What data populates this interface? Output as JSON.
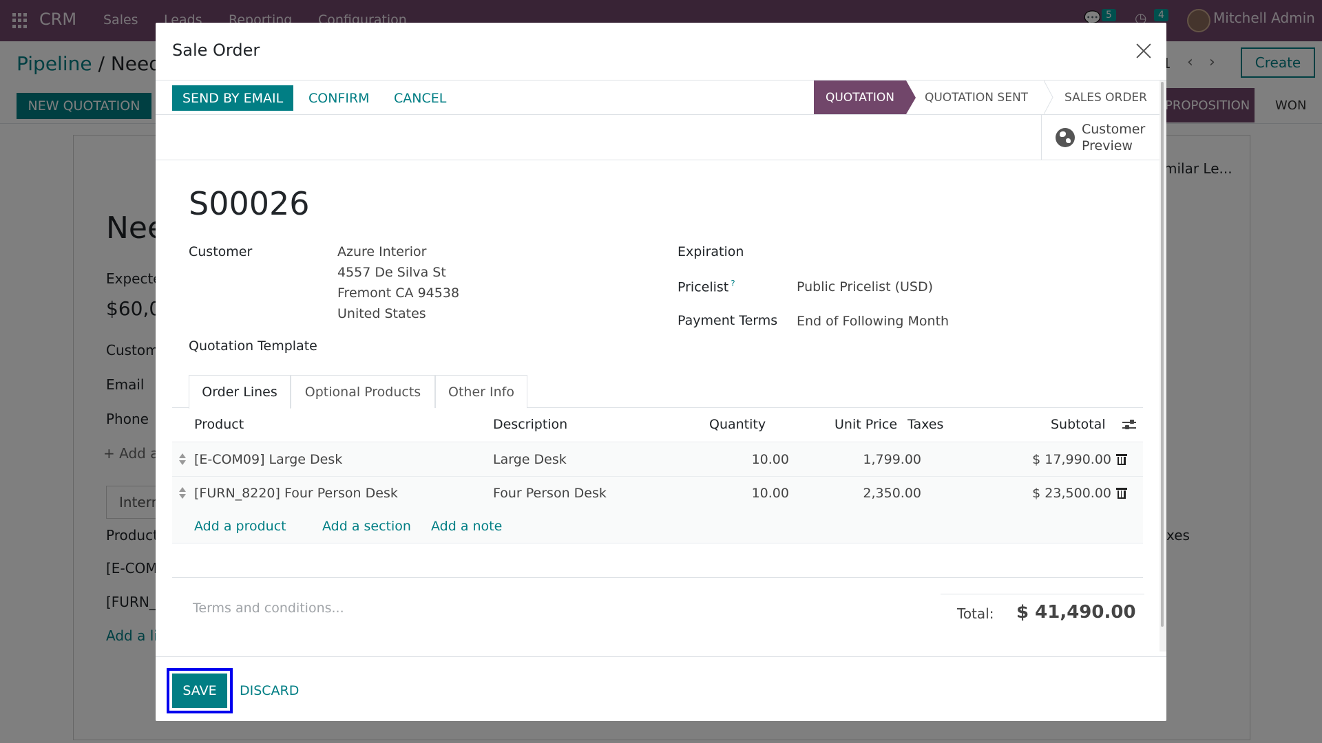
{
  "navbar": {
    "brand": "CRM",
    "menu": [
      "Sales",
      "Leads",
      "Reporting",
      "Configuration"
    ],
    "messages_count": "5",
    "activities_count": "4",
    "user_name": "Mitchell Admin"
  },
  "control_panel": {
    "breadcrumb_parent": "Pipeline",
    "breadcrumb_sep": "/",
    "breadcrumb_current": "Need",
    "pager": "1",
    "create_label": "Create",
    "new_quotation_label": "NEW QUOTATION",
    "stage_active": "PROPOSITION",
    "stage_won": "WON"
  },
  "background_form": {
    "title": "Nee",
    "expected_label": "Expecte",
    "expected_value": "$60,0",
    "customer_label": "Custom",
    "email_label": "Email",
    "phone_label": "Phone",
    "add_label": "Add a",
    "tab_internal": "Interr",
    "col_product": "Product",
    "col_taxes": "xes",
    "row1": "[E-COM",
    "row2": "[FURN_",
    "add_line": "Add a li",
    "similar": "milar Le..."
  },
  "modal": {
    "title": "Sale Order",
    "actions": {
      "send_email": "SEND BY EMAIL",
      "confirm": "CONFIRM",
      "cancel": "CANCEL"
    },
    "stages": [
      "QUOTATION",
      "QUOTATION SENT",
      "SALES ORDER"
    ],
    "active_stage": "QUOTATION",
    "customer_preview": [
      "Customer",
      "Preview"
    ],
    "order_name": "S00026",
    "fields": {
      "customer_label": "Customer",
      "customer_address": [
        "Azure Interior",
        "4557 De Silva St",
        "Fremont CA 94538",
        "United States"
      ],
      "quotation_template_label": "Quotation Template",
      "expiration_label": "Expiration",
      "pricelist_label": "Pricelist",
      "pricelist_help": "?",
      "pricelist_value": "Public Pricelist (USD)",
      "payment_terms_label": "Payment Terms",
      "payment_terms_value": "End of Following Month"
    },
    "tabs": [
      "Order Lines",
      "Optional Products",
      "Other Info"
    ],
    "columns": {
      "product": "Product",
      "description": "Description",
      "quantity": "Quantity",
      "unit_price": "Unit Price",
      "taxes": "Taxes",
      "subtotal": "Subtotal"
    },
    "lines": [
      {
        "product": "[E-COM09] Large Desk",
        "description": "Large Desk",
        "quantity": "10.00",
        "unit_price": "1,799.00",
        "taxes": "",
        "subtotal": "$ 17,990.00"
      },
      {
        "product": "[FURN_8220] Four Person Desk",
        "description": "Four Person Desk",
        "quantity": "10.00",
        "unit_price": "2,350.00",
        "taxes": "",
        "subtotal": "$ 23,500.00"
      }
    ],
    "add_links": {
      "product": "Add a product",
      "section": "Add a section",
      "note": "Add a note"
    },
    "terms_placeholder": "Terms and conditions...",
    "total_label": "Total:",
    "total_value": "$ 41,490.00",
    "footer": {
      "save": "SAVE",
      "discard": "DISCARD"
    }
  },
  "colors": {
    "brand": "#71466a",
    "primary": "#017e84",
    "highlight_outline": "#0000ee"
  }
}
